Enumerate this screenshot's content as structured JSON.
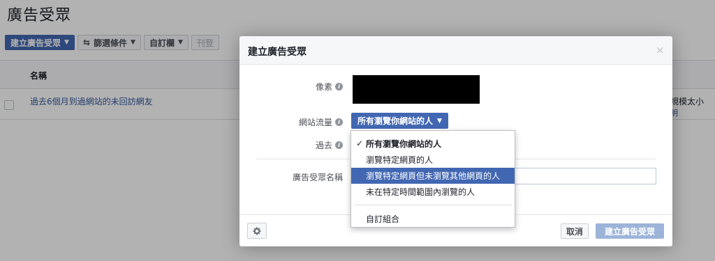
{
  "page": {
    "title": "廣告受眾"
  },
  "toolbar": {
    "create_audience": "建立廣告受眾",
    "filter": "篩選條件",
    "custom_columns": "自訂欄",
    "publish": "刊登"
  },
  "table": {
    "column_name": "名稱",
    "rows": [
      {
        "name": "過去6個月到過網站的未回訪網友",
        "extra1": "規模太小",
        "extra2": "明"
      }
    ]
  },
  "dialog": {
    "title": "建立廣告受眾",
    "close_icon": "×",
    "pixel_label": "像素",
    "traffic_label": "網站流量",
    "traffic_value": "所有瀏覽你網站的人",
    "past_label": "過去",
    "audience_name_label": "廣告受眾名稱",
    "cancel": "取消",
    "create": "建立廣告受眾"
  },
  "traffic_menu": {
    "items": [
      "所有瀏覽你網站的人",
      "瀏覽特定網頁的人",
      "瀏覽特定網頁但未瀏覽其他網頁的人",
      "未在特定時間範圍內瀏覽的人"
    ],
    "checked_index": 0,
    "highlighted_index": 2,
    "custom": "自訂組合"
  },
  "colors": {
    "accent": "#4267b2",
    "link": "#365899",
    "disabled_button": "#9cb4d8"
  }
}
